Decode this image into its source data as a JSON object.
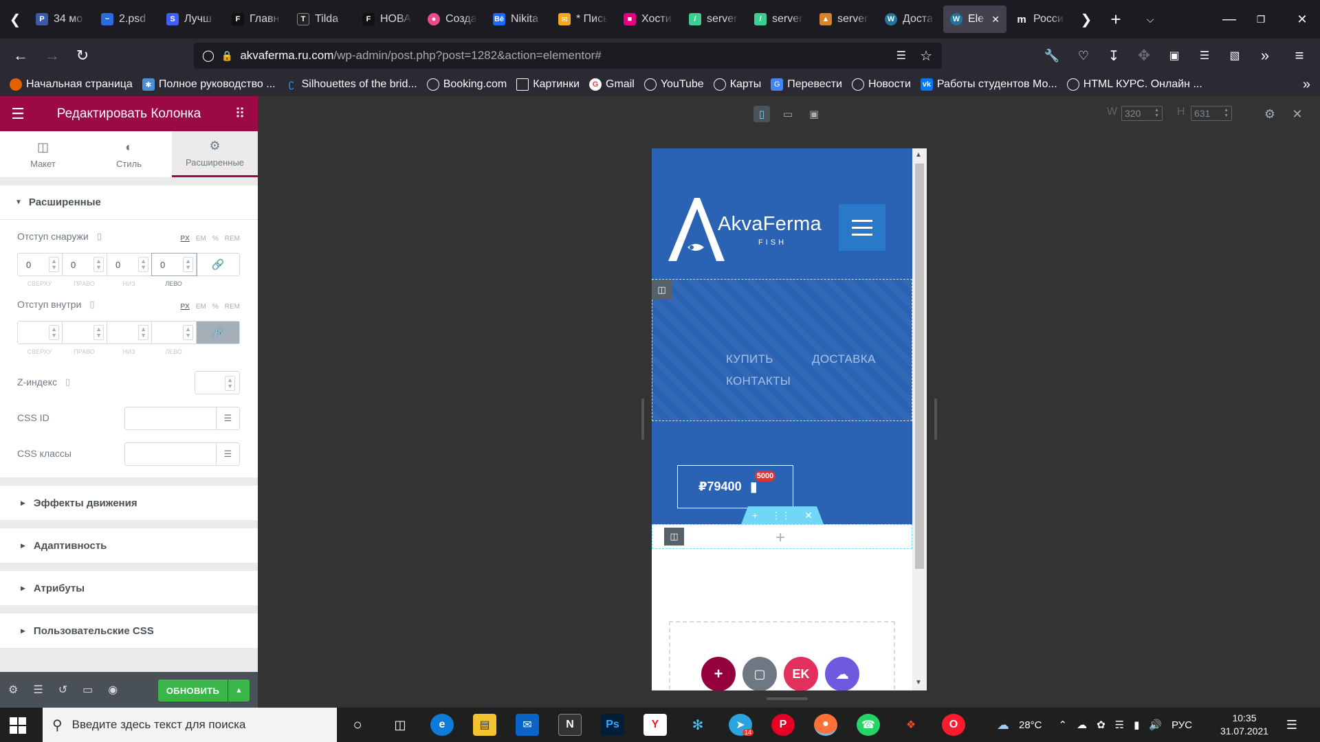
{
  "tabs": [
    {
      "label": "34 мо",
      "icon": "psd-icon",
      "color": "#3b5ba9"
    },
    {
      "label": "2.psd",
      "icon": "photopea-icon",
      "color": "#2d6cdf"
    },
    {
      "label": "Лучш",
      "icon": "s-icon",
      "color": "#3f5efb"
    },
    {
      "label": "Главн",
      "icon": "f-icon",
      "color": "#111111"
    },
    {
      "label": "Tilda",
      "icon": "tilda-icon",
      "color": "#222222"
    },
    {
      "label": "НОВА",
      "icon": "f-icon",
      "color": "#111111"
    },
    {
      "label": "Созда",
      "icon": "dribbble-icon",
      "color": "#ea4c89"
    },
    {
      "label": "Nikita",
      "icon": "behance-icon",
      "color": "#1769ff"
    },
    {
      "label": "* Пись",
      "icon": "mail-icon",
      "color": "#f5a623"
    },
    {
      "label": "Хости",
      "icon": "hosting-icon",
      "color": "#e6007e"
    },
    {
      "label": "server",
      "icon": "server-icon",
      "color": "#3ccf91"
    },
    {
      "label": "server",
      "icon": "server-icon",
      "color": "#3ccf91"
    },
    {
      "label": "server",
      "icon": "server-icon",
      "color": "#d9822b"
    },
    {
      "label": "Доста",
      "icon": "wordpress-icon",
      "color": "#21759b"
    },
    {
      "label": "Ele",
      "icon": "wordpress-icon",
      "color": "#21759b"
    },
    {
      "label": "Росси",
      "icon": "m-icon",
      "color": "#1c1b22"
    }
  ],
  "url": {
    "host": "akvaferma.ru.com",
    "path": "/wp-admin/post.php?post=1282&action=elementor#"
  },
  "bookmarks": [
    {
      "label": "Начальная страница",
      "color": "#e66000"
    },
    {
      "label": "Полное руководство ...",
      "color": "#4a90d9"
    },
    {
      "label": "Silhouettes of the brid...",
      "color": "#2196f3"
    },
    {
      "label": "Booking.com",
      "color": "#2b2a33"
    },
    {
      "label": "Картинки",
      "color": "#2b2a33"
    },
    {
      "label": "Gmail",
      "color": "#ffffff"
    },
    {
      "label": "YouTube",
      "color": "#2b2a33"
    },
    {
      "label": "Карты",
      "color": "#2b2a33"
    },
    {
      "label": "Перевести",
      "color": "#4285f4"
    },
    {
      "label": "Новости",
      "color": "#2b2a33"
    },
    {
      "label": "Работы студентов Мо...",
      "color": "#0077ff"
    },
    {
      "label": "HTML КУРС. Онлайн ...",
      "color": "#2b2a33"
    }
  ],
  "panel": {
    "title": "Редактировать Колонка",
    "tabs": [
      {
        "label": "Макет",
        "icon": "layout-icon"
      },
      {
        "label": "Стиль",
        "icon": "style-icon"
      },
      {
        "label": "Расширенные",
        "icon": "gear-icon"
      }
    ],
    "advanced": {
      "title": "Расширенные",
      "margin": {
        "label": "Отступ снаружи",
        "values": [
          "0",
          "0",
          "0",
          "0"
        ]
      },
      "padding": {
        "label": "Отступ внутри"
      },
      "units": [
        "PX",
        "EM",
        "%",
        "REM"
      ],
      "dim_labels": [
        "СВЕРХУ",
        "ПРАВО",
        "НИЗ",
        "ЛЕВО"
      ],
      "z_index": {
        "label": "Z-индекс"
      },
      "css_id": {
        "label": "CSS ID"
      },
      "css_classes": {
        "label": "CSS классы"
      }
    },
    "collapsed_sections": [
      "Эффекты движения",
      "Адаптивность",
      "Атрибуты",
      "Пользовательские CSS"
    ],
    "update_label": "ОБНОВИТЬ"
  },
  "preview": {
    "width_label": "W",
    "width": "320",
    "height_label": "H",
    "height": "631",
    "logo_text": "AkvaFerma",
    "logo_sub": "FISH",
    "nav": [
      "КУПИТЬ",
      "ДОСТАВКА",
      "КОНТАКТЫ"
    ],
    "cart_price": "₽79400",
    "cart_count": "5000"
  },
  "taskbar": {
    "search_placeholder": "Введите здесь текст для поиска",
    "temperature": "28°C",
    "lang": "РУС",
    "time": "10:35",
    "date": "31.07.2021",
    "notification_count": "14"
  },
  "colors": {
    "elementor_accent": "#9b0a46",
    "site_blue": "#2a63b4",
    "update_green": "#39b54a",
    "handle_cyan": "#71d7f7"
  }
}
